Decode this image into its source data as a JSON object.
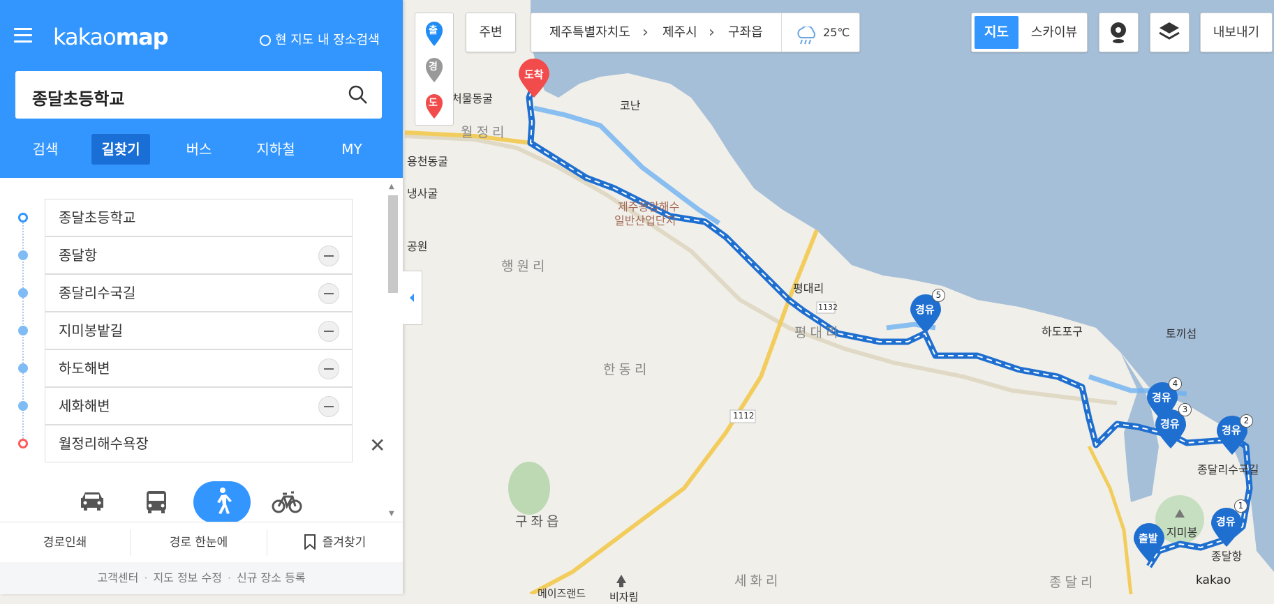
{
  "app": {
    "logo_light": "kakao",
    "logo_bold": "map"
  },
  "header": {
    "current_map_search": "현 지도 내 장소검색",
    "search_query": "종달초등학교",
    "tabs": [
      {
        "label": "검색",
        "active": false
      },
      {
        "label": "길찾기",
        "active": true
      },
      {
        "label": "버스",
        "active": false
      },
      {
        "label": "지하철",
        "active": false
      },
      {
        "label": "MY",
        "active": false
      }
    ]
  },
  "route": {
    "waypoints": [
      "종달초등학교",
      "종달항",
      "종달리수국길",
      "지미봉밭길",
      "하도해변",
      "세화해변",
      "월정리해수욕장"
    ],
    "modes": [
      "car-icon",
      "bus-icon",
      "walk-icon",
      "bicycle-icon"
    ],
    "active_mode": "walk-icon"
  },
  "bottombar": {
    "print": "경로인쇄",
    "overview": "경로 한눈에",
    "favorite": "즐겨찾기"
  },
  "footer": {
    "links": [
      "고객센터",
      "지도 정보 수정",
      "신규 장소 등록"
    ]
  },
  "map_controls": {
    "pins": {
      "start": "출",
      "via": "경",
      "end": "도"
    },
    "nearby": "주변",
    "breadcrumb": [
      "제주특별자치도",
      "제주시",
      "구좌읍"
    ],
    "weather": {
      "temp": "25℃",
      "icon": "rain-icon"
    },
    "map_type": {
      "map": "지도",
      "skyview": "스카이뷰"
    },
    "export": "내보내기",
    "attribution": "kakao"
  },
  "map_labels": {
    "cheomul": "처물동굴",
    "wolgeong": "월정리",
    "yongcheon": "용천동굴",
    "sagul": "냉사굴",
    "park": "공원",
    "industrial1": "제주용암해수",
    "industrial2": "일반산업단지",
    "haengwon": "행원리",
    "pyeongdae_beach": "평대리",
    "pyeongdae": "평대리",
    "handong": "한동리",
    "gujwa": "구좌읍",
    "sehwa": "세화리",
    "jongdal": "종달리",
    "hadopogu": "하도포구",
    "tokkiseom": "토끼섬",
    "jongdal_sugukgil": "종달리수국길",
    "jimibong": "지미봉",
    "jongdalhang": "종달항",
    "road_1112": "1112",
    "road_1132": "1132",
    "gonnae": "코난",
    "mazeland": "메이즈랜드",
    "bijarim": "비자림"
  },
  "route_markers": {
    "arrival": "도착",
    "departure": "출발",
    "via": [
      {
        "label": "경유",
        "num": "1"
      },
      {
        "label": "경유",
        "num": "2"
      },
      {
        "label": "경유",
        "num": "3"
      },
      {
        "label": "경유",
        "num": "4"
      },
      {
        "label": "경유",
        "num": "5"
      }
    ]
  },
  "colors": {
    "brand": "#3396ff",
    "active_tab": "#1a6fd6",
    "route": "#1f6fd0",
    "arrival": "#f24b4b",
    "sea": "#a5bfd8",
    "land": "#f1efe9"
  }
}
